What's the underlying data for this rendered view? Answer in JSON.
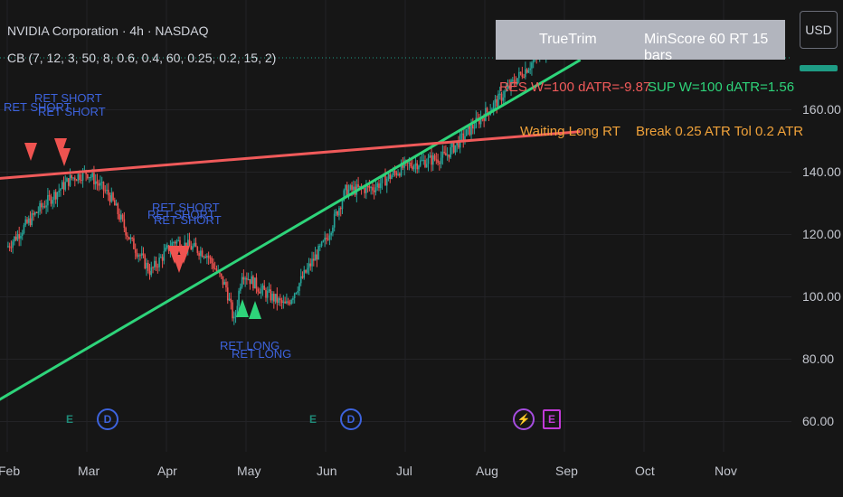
{
  "header": {
    "title": "NVIDIA Corporation · 4h · NASDAQ",
    "indicator": "CB (7, 12, 3, 50, 8, 0.6, 0.4, 60, 0.25, 0.2, 15, 2)"
  },
  "currency_button": "USD",
  "info_table": {
    "title": "TrueTrim",
    "settings": "MinScore 60  RT 15 bars",
    "res": "RES W=100  dATR=-9.87",
    "sup": "SUP W=100  dATR=1.56",
    "status": "Waiting Long RT",
    "break": "Break 0.25 ATR  Tol 0.2 ATR"
  },
  "colors": {
    "background": "#161616",
    "up_candle": "#26a69a",
    "down_candle": "#ef5350",
    "support_line": "#2ed47a",
    "resistance_line": "#f05a5a",
    "signal_text": "#3d63dd",
    "status_text": "#f0a23a",
    "earnings": "#1f8a78",
    "dividend": "#3d63dd",
    "split": "#a64de0"
  },
  "signals": [
    {
      "label": "RET SHORT",
      "type": "short"
    },
    {
      "label": "RET SHORT",
      "type": "short"
    },
    {
      "label": "RET SHORT",
      "type": "short"
    },
    {
      "label": "RET SHORT",
      "type": "short"
    },
    {
      "label": "RET SHORT",
      "type": "short"
    },
    {
      "label": "RET SHORT",
      "type": "short"
    },
    {
      "label": "RET LONG",
      "type": "long"
    },
    {
      "label": "RET LONG",
      "type": "long"
    }
  ],
  "event_icons": [
    {
      "letter": "E",
      "name": "earnings-icon"
    },
    {
      "letter": "D",
      "name": "dividend-icon"
    },
    {
      "letter": "E",
      "name": "earnings-icon"
    },
    {
      "letter": "D",
      "name": "dividend-icon"
    },
    {
      "letter": "⚡",
      "name": "split-icon"
    },
    {
      "letter": "E",
      "name": "earnings-icon"
    }
  ],
  "chart_data": {
    "type": "candlestick",
    "title": "NVIDIA Corporation · 4h · NASDAQ",
    "x_ticks": [
      "Feb",
      "Mar",
      "Apr",
      "May",
      "Jun",
      "Jul",
      "Aug",
      "Sep",
      "Oct",
      "Nov"
    ],
    "y_ticks": [
      60,
      80,
      100,
      120,
      140,
      160
    ],
    "ylim": [
      56,
      185
    ],
    "price_path": [
      {
        "x": 0.0,
        "y": 116
      },
      {
        "x": 0.4,
        "y": 128
      },
      {
        "x": 0.8,
        "y": 138
      },
      {
        "x": 1.0,
        "y": 140
      },
      {
        "x": 1.3,
        "y": 132
      },
      {
        "x": 1.55,
        "y": 118
      },
      {
        "x": 1.8,
        "y": 108
      },
      {
        "x": 2.1,
        "y": 118
      },
      {
        "x": 2.5,
        "y": 114
      },
      {
        "x": 2.75,
        "y": 103
      },
      {
        "x": 2.85,
        "y": 92
      },
      {
        "x": 2.95,
        "y": 108
      },
      {
        "x": 3.2,
        "y": 102
      },
      {
        "x": 3.5,
        "y": 97
      },
      {
        "x": 3.8,
        "y": 110
      },
      {
        "x": 4.0,
        "y": 118
      },
      {
        "x": 4.25,
        "y": 134
      },
      {
        "x": 4.6,
        "y": 135
      },
      {
        "x": 5.0,
        "y": 142
      },
      {
        "x": 5.5,
        "y": 145
      },
      {
        "x": 5.9,
        "y": 156
      },
      {
        "x": 6.2,
        "y": 164
      },
      {
        "x": 6.4,
        "y": 170
      },
      {
        "x": 6.7,
        "y": 178
      },
      {
        "x": 6.9,
        "y": 181
      },
      {
        "x": 7.1,
        "y": 181
      },
      {
        "x": 7.2,
        "y": 179
      }
    ],
    "support_line": [
      {
        "x": -0.1,
        "y": 67
      },
      {
        "x": 7.2,
        "y": 176
      }
    ],
    "resistance_line": [
      {
        "x": -0.1,
        "y": 138
      },
      {
        "x": 7.2,
        "y": 153
      }
    ]
  }
}
